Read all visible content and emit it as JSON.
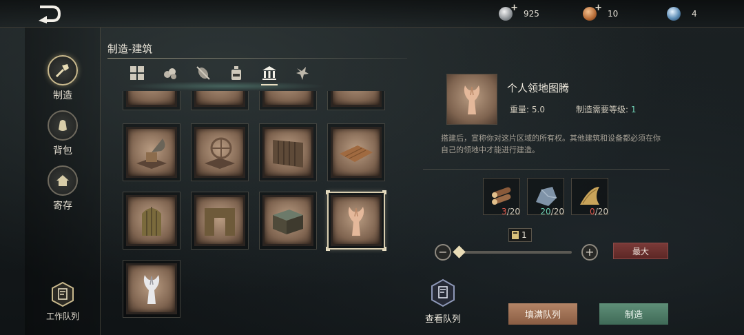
{
  "currencies": [
    {
      "icon": "silver-coin-icon",
      "value": "925"
    },
    {
      "icon": "bronze-coin-icon",
      "value": "10"
    },
    {
      "icon": "blue-orb-icon",
      "value": "4"
    }
  ],
  "nav": {
    "craft": "制造",
    "backpack": "背包",
    "storage": "寄存",
    "work_queue": "工作队列"
  },
  "category": {
    "title": "制造-建筑",
    "tabs": [
      "grid-icon",
      "resource-icon",
      "plant-icon",
      "bottle-icon",
      "building-icon",
      "creature-icon"
    ],
    "active_tab": "building-icon"
  },
  "items": [
    {
      "name": "partial-item-1"
    },
    {
      "name": "partial-item-2"
    },
    {
      "name": "partial-item-3"
    },
    {
      "name": "partial-item-4"
    },
    {
      "name": "gramophone-bench"
    },
    {
      "name": "spinning-wheel"
    },
    {
      "name": "wooden-gate"
    },
    {
      "name": "wooden-floor"
    },
    {
      "name": "wooden-door"
    },
    {
      "name": "door-frame"
    },
    {
      "name": "wooden-crate"
    },
    {
      "name": "territory-totem",
      "selected": true
    },
    {
      "name": "silver-totem"
    }
  ],
  "detail": {
    "name": "个人领地图腾",
    "weight_label": "重量:",
    "weight_value": "5.0",
    "level_label": "制造需要等级:",
    "level_value": "1",
    "description": "搭建后，宣称你对这片区域的所有权。其他建筑和设备都必须在你自己的领地中才能进行建造。"
  },
  "materials": [
    {
      "icon": "logs-icon",
      "have": "3",
      "need": "/20",
      "color": "#e05a4e"
    },
    {
      "icon": "stone-icon",
      "have": "20",
      "need": "/20",
      "color": "#6fd0b4"
    },
    {
      "icon": "fiber-icon",
      "have": "0",
      "need": "/20",
      "color": "#e05a4e"
    }
  ],
  "quantity": {
    "value": "1",
    "minus": "−",
    "plus": "+",
    "max_label": "最大",
    "slider_fraction": 0.0
  },
  "actions": {
    "view_queue": "查看队列",
    "fill_queue": "填满队列",
    "craft": "制造"
  }
}
